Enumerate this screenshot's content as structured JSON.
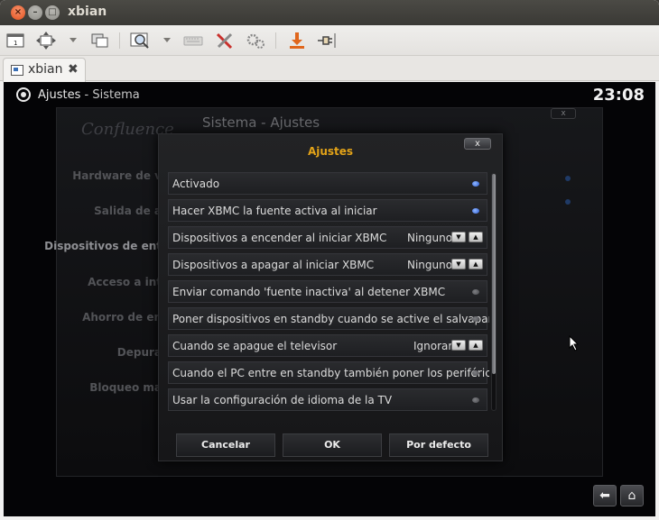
{
  "window": {
    "title": "xbian"
  },
  "tab": {
    "label": "xbian"
  },
  "toolbar": {
    "icons": [
      "window-icon",
      "move-icon",
      "windows-icon",
      "zoom-icon",
      "keyboard-icon",
      "tools-icon",
      "settings-icon",
      "download-icon",
      "plug-icon"
    ]
  },
  "header": {
    "section": "Ajustes",
    "subsection": "- Sistema",
    "clock": "23:08"
  },
  "background": {
    "logo": "Confluence",
    "title": "Sistema - Ajustes",
    "close": "x",
    "menu": [
      "Hardware de v",
      "Salida de a",
      "Dispositivos de ent",
      "Acceso a int",
      "Ahorro de en",
      "Depura",
      "Bloqueo ma"
    ]
  },
  "dialog": {
    "title": "Ajustes",
    "close": "x",
    "rows": [
      {
        "label": "Activado",
        "type": "radio",
        "on": true
      },
      {
        "label": "Hacer XBMC la fuente activa al iniciar",
        "type": "radio",
        "on": true
      },
      {
        "label": "Dispositivos a encender al iniciar XBMC",
        "type": "spin",
        "value": "Ninguno"
      },
      {
        "label": "Dispositivos a apagar al iniciar XBMC",
        "type": "spin",
        "value": "Ninguno"
      },
      {
        "label": "Enviar comando 'fuente inactiva' al detener XBMC",
        "type": "radio",
        "on": false
      },
      {
        "label": "Poner dispositivos en standby cuando se active el salvapantallas",
        "type": "radio",
        "on": false
      },
      {
        "label": "Cuando se apague el televisor",
        "type": "spin",
        "value": "Ignorar"
      },
      {
        "label": "Cuando el PC entre en standby también poner los periféricos",
        "type": "radio",
        "on": false
      },
      {
        "label": "Usar la configuración de idioma de la TV",
        "type": "radio",
        "on": false
      }
    ],
    "buttons": {
      "cancel": "Cancelar",
      "ok": "OK",
      "default": "Por defecto"
    }
  },
  "nav": {
    "back": "back-arrow-icon",
    "home": "home-icon"
  },
  "colors": {
    "accent": "#e3a318",
    "radio_on": "#2b5bd3"
  }
}
